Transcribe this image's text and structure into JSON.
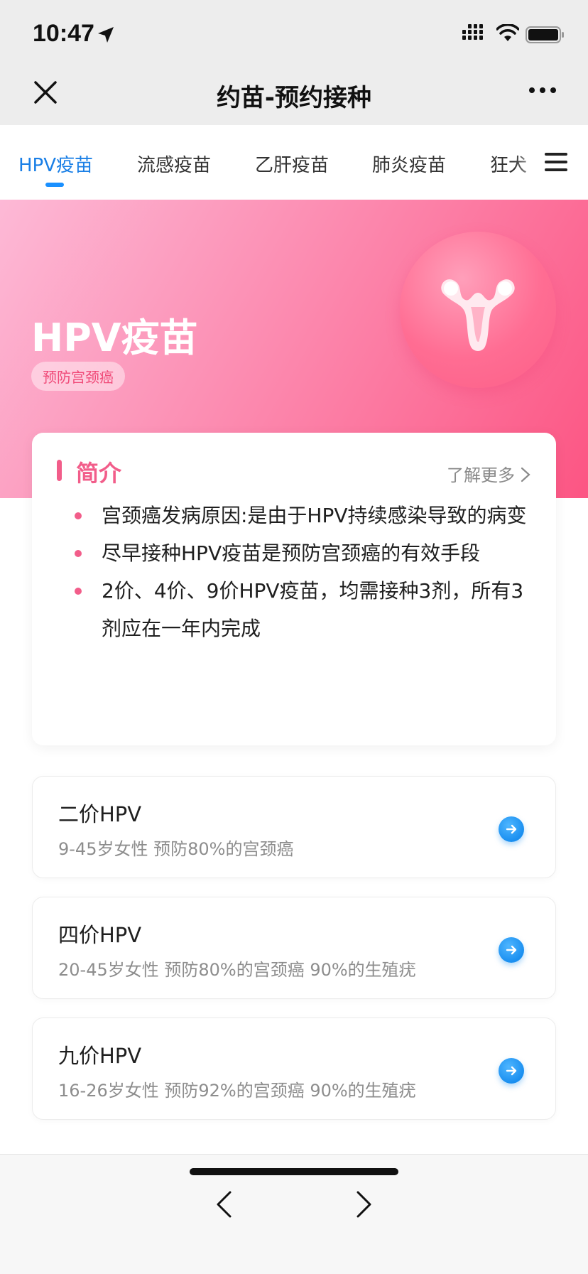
{
  "status_bar": {
    "time": "10:47"
  },
  "nav": {
    "title": "约苗-预约接种",
    "close_icon": "close-icon",
    "more_icon": "more-icon"
  },
  "tabs": [
    {
      "label": "HPV疫苗",
      "active": true
    },
    {
      "label": "流感疫苗",
      "active": false
    },
    {
      "label": "乙肝疫苗",
      "active": false
    },
    {
      "label": "肺炎疫苗",
      "active": false
    },
    {
      "label": "狂犬",
      "active": false
    }
  ],
  "hero": {
    "title": "HPV疫苗",
    "tag": "预防宫颈癌",
    "icon": "uterus-icon"
  },
  "intro": {
    "title": "简介",
    "more_label": "了解更多",
    "bullets": [
      "宫颈癌发病原因:是由于HPV持续感染导致的病变",
      "尽早接种HPV疫苗是预防宫颈癌的有效手段",
      "2价、4价、9价HPV疫苗，均需接种3剂，所有3剂应在一年内完成"
    ]
  },
  "vaccines": [
    {
      "name": "二价HPV",
      "desc": "9-45岁女性 预防80%的宫颈癌"
    },
    {
      "name": "四价HPV",
      "desc": "20-45岁女性 预防80%的宫颈癌 90%的生殖疣"
    },
    {
      "name": "九价HPV",
      "desc": "16-26岁女性 预防92%的宫颈癌 90%的生殖疣"
    }
  ],
  "colors": {
    "accent_blue": "#1a90ff",
    "accent_pink": "#f25d8a"
  }
}
